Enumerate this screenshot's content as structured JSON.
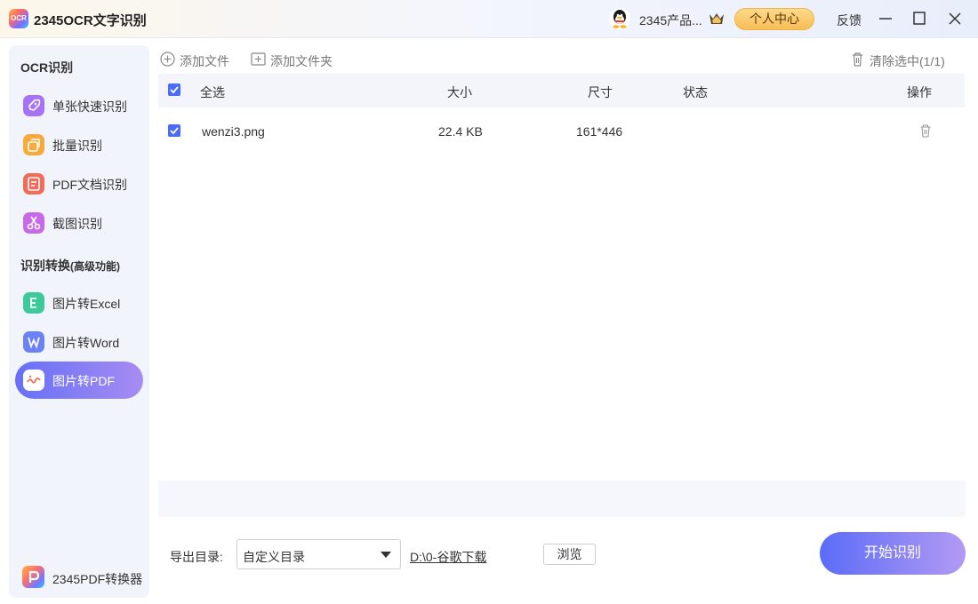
{
  "app": {
    "title": "2345OCR文字识别",
    "logo_text": "OCR",
    "username": "2345产品...",
    "vip_button": "个人中心",
    "feedback": "反馈"
  },
  "sidebar": {
    "section_ocr": "OCR识别",
    "section_convert": "识别转换",
    "section_convert_note": "(高级功能)",
    "items": [
      {
        "label": "单张快速识别",
        "icon": "rocket-icon",
        "color": "#a872f5"
      },
      {
        "label": "批量识别",
        "icon": "batch-icon",
        "color": "#f7a93a"
      },
      {
        "label": "PDF文档识别",
        "icon": "pdf-doc-icon",
        "color": "#f26c5b"
      },
      {
        "label": "截图识别",
        "icon": "scissors-icon",
        "color": "#c86ae8"
      },
      {
        "label": "图片转Excel",
        "icon": "excel-icon",
        "color": "#3ec99a"
      },
      {
        "label": "图片转Word",
        "icon": "word-icon",
        "color": "#6b82f5"
      },
      {
        "label": "图片转PDF",
        "icon": "image-pdf-icon",
        "color": "#f26c5b",
        "active": true
      }
    ],
    "bottom_app": "2345PDF转换器"
  },
  "toolbar": {
    "add_file": "添加文件",
    "add_folder": "添加文件夹",
    "clear_selected": "清除选中(1/1)"
  },
  "table": {
    "headers": {
      "select_all": "全选",
      "size": "大小",
      "dimensions": "尺寸",
      "status": "状态",
      "action": "操作"
    },
    "rows": [
      {
        "name": "wenzi3.png",
        "size": "22.4 KB",
        "dimensions": "161*446",
        "status": "",
        "checked": true
      }
    ]
  },
  "footer": {
    "export_label": "导出目录:",
    "export_select": "自定义目录",
    "export_path": "D:\\0-谷歌下载",
    "browse": "浏览",
    "start": "开始识别"
  },
  "colors": {
    "accent": "#4a6cf7",
    "start_gradient_from": "#5c6cf7",
    "start_gradient_to": "#b29af4",
    "vip_gold": "#f7bd55"
  }
}
